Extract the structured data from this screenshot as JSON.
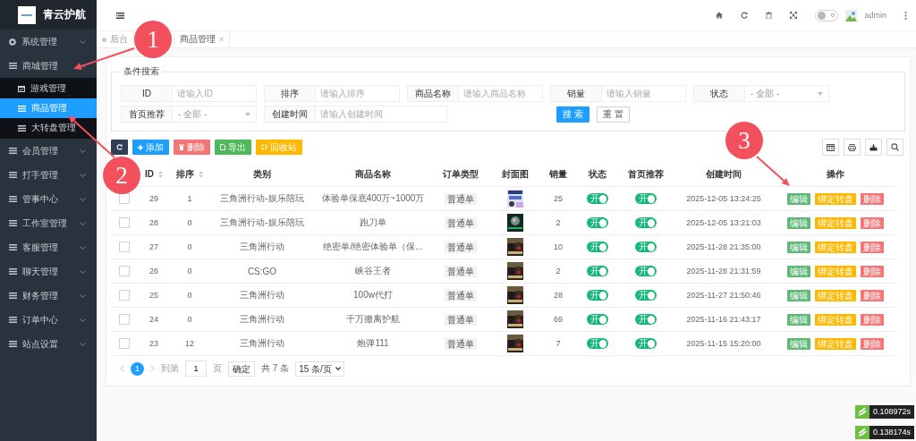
{
  "sidebar": {
    "logo_text": "青云护航",
    "items": [
      {
        "label": "系统管理",
        "expanded": false
      },
      {
        "label": "商城管理",
        "expanded": true,
        "children": [
          {
            "label": "游戏管理",
            "selected": false
          },
          {
            "label": "商品管理",
            "selected": true
          },
          {
            "label": "大转盘管理",
            "selected": false
          }
        ]
      },
      {
        "label": "会员管理",
        "expanded": false
      },
      {
        "label": "打手管理",
        "expanded": false
      },
      {
        "label": "管事中心",
        "expanded": false
      },
      {
        "label": "工作室管理",
        "expanded": false
      },
      {
        "label": "客服管理",
        "expanded": false
      },
      {
        "label": "聊天管理",
        "expanded": false
      },
      {
        "label": "财务管理",
        "expanded": false
      },
      {
        "label": "订单中心",
        "expanded": false
      },
      {
        "label": "站点设置",
        "expanded": false
      }
    ]
  },
  "header": {
    "user": "admin",
    "dark_mode": false
  },
  "tabs": [
    {
      "label": "后台",
      "selected": false
    },
    {
      "label": "商品管理",
      "selected": true,
      "close": "×"
    }
  ],
  "search": {
    "legend": "条件搜索",
    "fields": [
      {
        "label": "ID",
        "kind": "input",
        "placeholder": "请输入ID"
      },
      {
        "label": "排序",
        "kind": "input",
        "placeholder": "请输入排序"
      },
      {
        "label": "商品名称",
        "kind": "input",
        "placeholder": "请输入商品名称"
      },
      {
        "label": "销量",
        "kind": "input",
        "placeholder": "请输入销量"
      },
      {
        "label": "状态",
        "kind": "select",
        "value": "- 全部 -"
      },
      {
        "label": "首页推荐",
        "kind": "select",
        "value": "- 全部 -"
      },
      {
        "label": "创建时间",
        "kind": "date",
        "placeholder": "请输入创建时间"
      }
    ],
    "buttons": [
      {
        "label": "搜 索",
        "kind": "primary"
      },
      {
        "label": "重 置",
        "kind": "plain"
      }
    ]
  },
  "toolbar": {
    "buttons": [
      {
        "kind": "refresh"
      },
      {
        "kind": "add",
        "label": "添加"
      },
      {
        "kind": "delete",
        "label": "删除"
      },
      {
        "kind": "export",
        "label": "导出"
      },
      {
        "kind": "recycle",
        "label": "回收站"
      }
    ],
    "tools": [
      {
        "kind": "columns"
      },
      {
        "kind": "print"
      },
      {
        "kind": "export"
      },
      {
        "kind": "search"
      }
    ]
  },
  "table": {
    "columns": [
      {
        "label": "ID",
        "sortable": true
      },
      {
        "label": "排序",
        "sortable": true
      },
      {
        "label": "类别",
        "sortable": false
      },
      {
        "label": "商品名称",
        "sortable": false
      },
      {
        "label": "订单类型",
        "sortable": false
      },
      {
        "label": "封面图",
        "sortable": false
      },
      {
        "label": "销量",
        "sortable": false
      },
      {
        "label": "状态",
        "sortable": false
      },
      {
        "label": "首页推荐",
        "sortable": false
      },
      {
        "label": "创建时间",
        "sortable": false
      },
      {
        "label": "操作",
        "sortable": false
      }
    ],
    "rows": [
      {
        "checked": false,
        "id": "29",
        "sort": "1",
        "category": "三角洲行动-娱乐陪玩",
        "name": "体验单保底400万~1000万",
        "order_type": "普通单",
        "cover": {
          "kind": "picture"
        },
        "sales": "25",
        "status": {
          "label": "开",
          "on": true
        },
        "recommended": {
          "label": "开",
          "on": true
        },
        "created": "2025-12-05 13:24:25",
        "actions": [
          {
            "kind": "edit",
            "label": "编辑"
          },
          {
            "kind": "bind",
            "label": "绑定转盘"
          },
          {
            "kind": "delete",
            "label": "删除"
          }
        ]
      },
      {
        "checked": false,
        "id": "28",
        "sort": "0",
        "category": "三角洲行动-娱乐陪玩",
        "name": "跑刀单",
        "order_type": "普通单",
        "cover": {
          "kind": "picture"
        },
        "sales": "2",
        "status": {
          "label": "开",
          "on": true
        },
        "recommended": {
          "label": "开",
          "on": true
        },
        "created": "2025-12-05 13:21:03",
        "actions": [
          {
            "kind": "edit",
            "label": "编辑"
          },
          {
            "kind": "bind",
            "label": "绑定转盘"
          },
          {
            "kind": "delete",
            "label": "删除"
          }
        ]
      },
      {
        "checked": false,
        "id": "27",
        "sort": "0",
        "category": "三角洲行动",
        "name": "绝密单/绝密体验单（保...",
        "order_type": "普通单",
        "cover": {
          "kind": "picture"
        },
        "sales": "10",
        "status": {
          "label": "开",
          "on": true
        },
        "recommended": {
          "label": "开",
          "on": true
        },
        "created": "2025-11-28 21:35:00",
        "actions": [
          {
            "kind": "edit",
            "label": "编辑"
          },
          {
            "kind": "bind",
            "label": "绑定转盘"
          },
          {
            "kind": "delete",
            "label": "删除"
          }
        ]
      },
      {
        "checked": false,
        "id": "26",
        "sort": "0",
        "category": "CS:GO",
        "name": "峡谷王者",
        "order_type": "普通单",
        "cover": {
          "kind": "picture"
        },
        "sales": "2",
        "status": {
          "label": "开",
          "on": true
        },
        "recommended": {
          "label": "开",
          "on": true
        },
        "created": "2025-11-28 21:31:59",
        "actions": [
          {
            "kind": "edit",
            "label": "编辑"
          },
          {
            "kind": "bind",
            "label": "绑定转盘"
          },
          {
            "kind": "delete",
            "label": "删除"
          }
        ]
      },
      {
        "checked": false,
        "id": "25",
        "sort": "0",
        "category": "三角洲行动",
        "name": "100w代打",
        "order_type": "普通单",
        "cover": {
          "kind": "picture"
        },
        "sales": "28",
        "status": {
          "label": "开",
          "on": true
        },
        "recommended": {
          "label": "开",
          "on": true
        },
        "created": "2025-11-27 21:50:46",
        "actions": [
          {
            "kind": "edit",
            "label": "编辑"
          },
          {
            "kind": "bind",
            "label": "绑定转盘"
          },
          {
            "kind": "delete",
            "label": "删除"
          }
        ]
      },
      {
        "checked": false,
        "id": "24",
        "sort": "0",
        "category": "三角洲行动",
        "name": "千万撤离护航",
        "order_type": "普通单",
        "cover": {
          "kind": "picture"
        },
        "sales": "69",
        "status": {
          "label": "开",
          "on": true
        },
        "recommended": {
          "label": "开",
          "on": true
        },
        "created": "2025-11-16 21:43:17",
        "actions": [
          {
            "kind": "edit",
            "label": "编辑"
          },
          {
            "kind": "bind",
            "label": "绑定转盘"
          },
          {
            "kind": "delete",
            "label": "删除"
          }
        ]
      },
      {
        "checked": false,
        "id": "23",
        "sort": "12",
        "category": "三角洲行动",
        "name": "炮弹111",
        "order_type": "普通单",
        "cover": {
          "kind": "picture"
        },
        "sales": "7",
        "status": {
          "label": "开",
          "on": true
        },
        "recommended": {
          "label": "开",
          "on": true
        },
        "created": "2025-11-15 15:20:00",
        "actions": [
          {
            "kind": "edit",
            "label": "编辑"
          },
          {
            "kind": "bind",
            "label": "绑定转盘"
          },
          {
            "kind": "delete",
            "label": "删除"
          }
        ]
      }
    ]
  },
  "pager": {
    "pages": [
      {
        "label": "1",
        "selected": true
      }
    ],
    "goto_label": "到第",
    "goto_value": "1",
    "page_unit": "页",
    "confirm": "确定",
    "total": "共 7 条",
    "page_size": "15 条/页"
  },
  "timers": [
    "0.108972s",
    "0.138174s"
  ],
  "annotations": [
    {
      "label": "1"
    },
    {
      "label": "2"
    },
    {
      "label": "3"
    }
  ]
}
